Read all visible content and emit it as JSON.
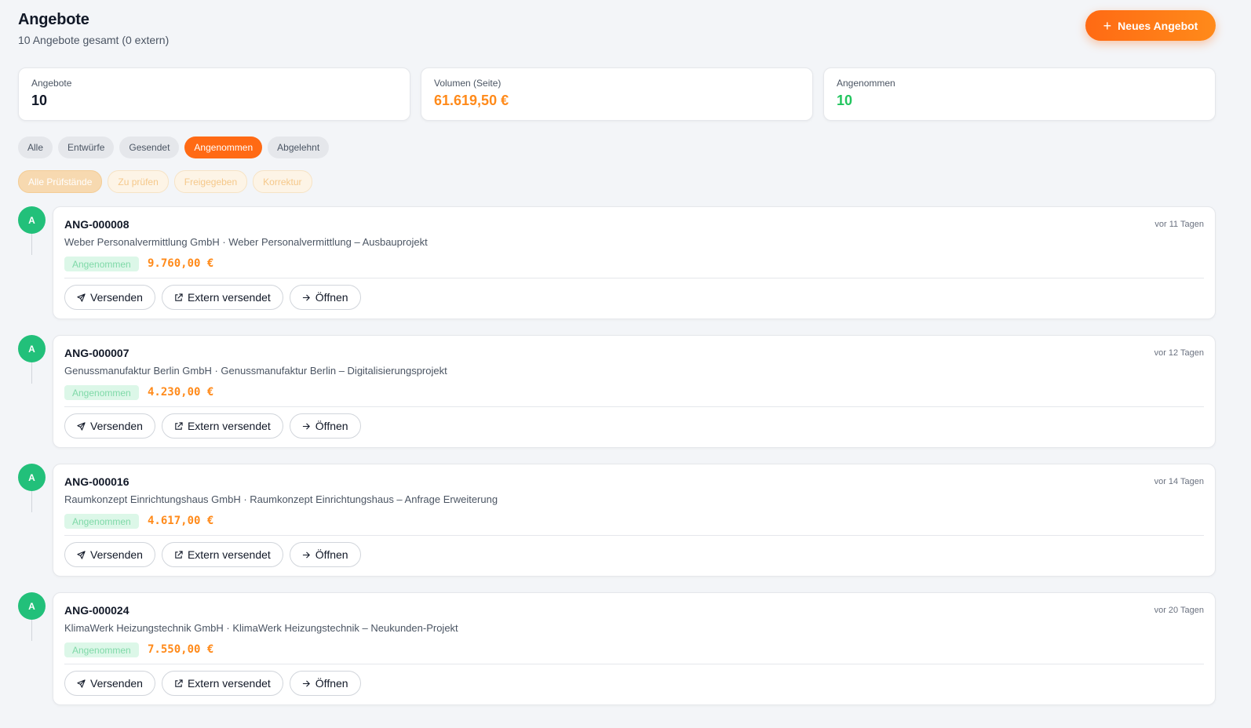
{
  "header": {
    "title": "Angebote",
    "subtitle": "10 Angebote gesamt (0 extern)",
    "new_button_label": "Neues Angebot"
  },
  "stats": [
    {
      "label": "Angebote",
      "value": "10",
      "color": "#111827"
    },
    {
      "label": "Volumen (Seite)",
      "value": "61.619,50 €",
      "color": "#ff8a1a"
    },
    {
      "label": "Angenommen",
      "value": "10",
      "color": "#22c55e"
    }
  ],
  "status_filters": {
    "active_index": 3,
    "items": [
      "Alle",
      "Entwürfe",
      "Gesendet",
      "Angenommen",
      "Abgelehnt"
    ]
  },
  "review_filters": {
    "active_index": 0,
    "items": [
      "Alle Prüfstände",
      "Zu prüfen",
      "Freigegeben",
      "Korrektur"
    ]
  },
  "offers": [
    {
      "avatar": "A",
      "id": "ANG-000008",
      "description": "Weber Personalvermittlung GmbH · Weber Personalvermittlung – Ausbauprojekt",
      "status": "Angenommen",
      "amount": "9.760,00 €",
      "time": "vor 11 Tagen"
    },
    {
      "avatar": "A",
      "id": "ANG-000007",
      "description": "Genussmanufaktur Berlin GmbH · Genussmanufaktur Berlin – Digitalisierungsprojekt",
      "status": "Angenommen",
      "amount": "4.230,00 €",
      "time": "vor 12 Tagen"
    },
    {
      "avatar": "A",
      "id": "ANG-000016",
      "description": "Raumkonzept Einrichtungshaus GmbH · Raumkonzept Einrichtungshaus – Anfrage Erweiterung",
      "status": "Angenommen",
      "amount": "4.617,00 €",
      "time": "vor 14 Tagen"
    },
    {
      "avatar": "A",
      "id": "ANG-000024",
      "description": "KlimaWerk Heizungstechnik GmbH · KlimaWerk Heizungstechnik – Neukunden-Projekt",
      "status": "Angenommen",
      "amount": "7.550,00 €",
      "time": "vor 20 Tagen"
    }
  ],
  "actions": {
    "send": "Versenden",
    "external": "Extern versendet",
    "open": "Öffnen"
  },
  "icons": {
    "send": "send-icon",
    "external": "external-link-icon",
    "open": "arrow-right-icon",
    "new": "plus-icon"
  }
}
